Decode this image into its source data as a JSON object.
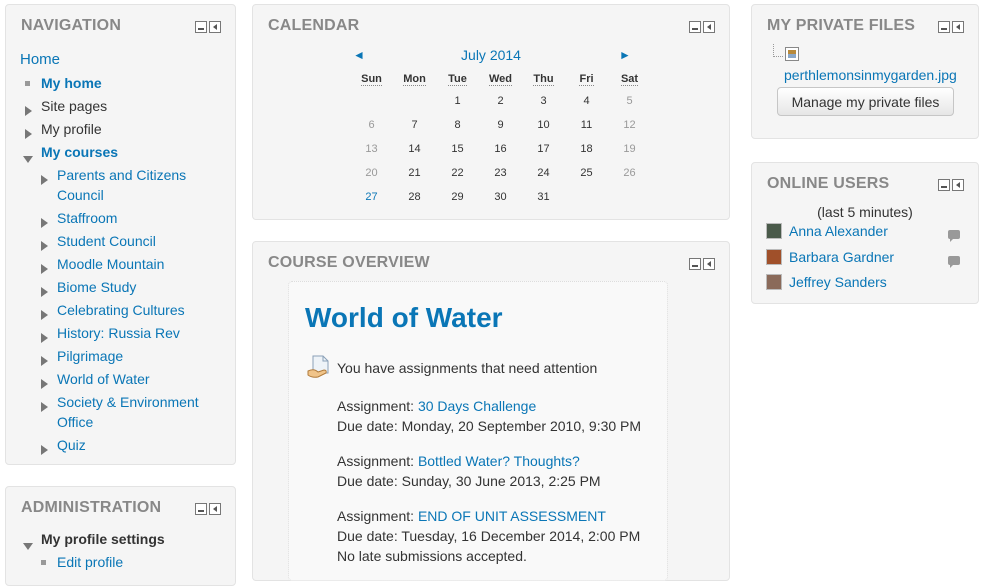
{
  "navigation": {
    "title": "NAVIGATION",
    "home": "Home",
    "my_home": "My home",
    "site_pages": "Site pages",
    "my_profile": "My profile",
    "my_courses": "My courses",
    "courses": [
      {
        "label": "Parents and Citizens Council"
      },
      {
        "label": "Staffroom"
      },
      {
        "label": "Student Council"
      },
      {
        "label": "Moodle Mountain"
      },
      {
        "label": "Biome Study"
      },
      {
        "label": "Celebrating Cultures"
      },
      {
        "label": "History: Russia Rev"
      },
      {
        "label": "Pilgrimage"
      },
      {
        "label": "World of Water"
      },
      {
        "label": "Society & Environment Office"
      },
      {
        "label": "Quiz"
      }
    ]
  },
  "administration": {
    "title": "ADMINISTRATION",
    "profile_settings": "My profile settings",
    "edit_profile": "Edit profile"
  },
  "calendar": {
    "title": "CALENDAR",
    "month": "July 2014",
    "prev": "◄",
    "next": "►",
    "weekdays": [
      "Sun",
      "Mon",
      "Tue",
      "Wed",
      "Thu",
      "Fri",
      "Sat"
    ],
    "weeks": [
      [
        "",
        "",
        "1",
        "2",
        "3",
        "4",
        "5"
      ],
      [
        "6",
        "7",
        "8",
        "9",
        "10",
        "11",
        "12"
      ],
      [
        "13",
        "14",
        "15",
        "16",
        "17",
        "18",
        "19"
      ],
      [
        "20",
        "21",
        "22",
        "23",
        "24",
        "25",
        "26"
      ],
      [
        "27",
        "28",
        "29",
        "30",
        "31",
        "",
        ""
      ]
    ],
    "today": "27"
  },
  "course_overview": {
    "title": "COURSE OVERVIEW",
    "course_name": "World of Water",
    "notice": "You have assignments that need attention",
    "assignments": [
      {
        "prefix": "Assignment: ",
        "name": "30 Days Challenge",
        "due": "Due date: Monday, 20 September 2010, 9:30 PM",
        "note": ""
      },
      {
        "prefix": "Assignment: ",
        "name": "Bottled Water? Thoughts?",
        "due": "Due date: Sunday, 30 June 2013, 2:25 PM",
        "note": ""
      },
      {
        "prefix": "Assignment: ",
        "name": "END OF UNIT ASSESSMENT",
        "due": "Due date: Tuesday, 16 December 2014, 2:00 PM",
        "note": "No late submissions accepted."
      }
    ]
  },
  "private_files": {
    "title": "MY PRIVATE FILES",
    "file_name": "perthlemonsinmygarden.jpg",
    "manage_button": "Manage my private files"
  },
  "online_users": {
    "title": "ONLINE USERS",
    "subtitle": "(last 5 minutes)",
    "users": [
      {
        "name": "Anna Alexander",
        "avatar_color": "#4a5a4a"
      },
      {
        "name": "Barbara Gardner",
        "avatar_color": "#a0502a"
      },
      {
        "name": "Jeffrey Sanders",
        "avatar_color": "#8a6a5a"
      }
    ]
  },
  "colors": {
    "link": "#0a76b6",
    "block_bg": "#f5f5f5",
    "title_gray": "#888888"
  }
}
